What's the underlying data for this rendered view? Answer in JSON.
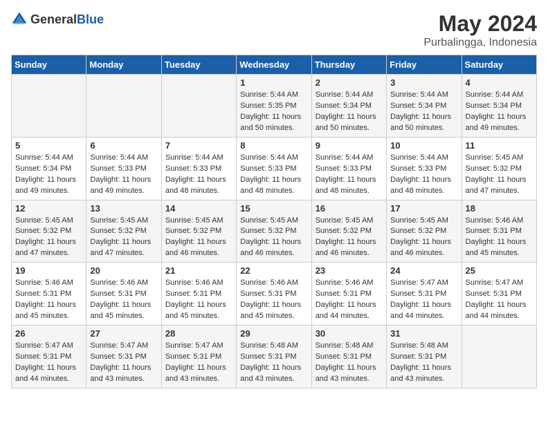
{
  "header": {
    "logo_general": "General",
    "logo_blue": "Blue",
    "month_year": "May 2024",
    "location": "Purbalingga, Indonesia"
  },
  "days_of_week": [
    "Sunday",
    "Monday",
    "Tuesday",
    "Wednesday",
    "Thursday",
    "Friday",
    "Saturday"
  ],
  "weeks": [
    [
      {
        "day": "",
        "info": ""
      },
      {
        "day": "",
        "info": ""
      },
      {
        "day": "",
        "info": ""
      },
      {
        "day": "1",
        "info": "Sunrise: 5:44 AM\nSunset: 5:35 PM\nDaylight: 11 hours\nand 50 minutes."
      },
      {
        "day": "2",
        "info": "Sunrise: 5:44 AM\nSunset: 5:34 PM\nDaylight: 11 hours\nand 50 minutes."
      },
      {
        "day": "3",
        "info": "Sunrise: 5:44 AM\nSunset: 5:34 PM\nDaylight: 11 hours\nand 50 minutes."
      },
      {
        "day": "4",
        "info": "Sunrise: 5:44 AM\nSunset: 5:34 PM\nDaylight: 11 hours\nand 49 minutes."
      }
    ],
    [
      {
        "day": "5",
        "info": "Sunrise: 5:44 AM\nSunset: 5:34 PM\nDaylight: 11 hours\nand 49 minutes."
      },
      {
        "day": "6",
        "info": "Sunrise: 5:44 AM\nSunset: 5:33 PM\nDaylight: 11 hours\nand 49 minutes."
      },
      {
        "day": "7",
        "info": "Sunrise: 5:44 AM\nSunset: 5:33 PM\nDaylight: 11 hours\nand 48 minutes."
      },
      {
        "day": "8",
        "info": "Sunrise: 5:44 AM\nSunset: 5:33 PM\nDaylight: 11 hours\nand 48 minutes."
      },
      {
        "day": "9",
        "info": "Sunrise: 5:44 AM\nSunset: 5:33 PM\nDaylight: 11 hours\nand 48 minutes."
      },
      {
        "day": "10",
        "info": "Sunrise: 5:44 AM\nSunset: 5:33 PM\nDaylight: 11 hours\nand 48 minutes."
      },
      {
        "day": "11",
        "info": "Sunrise: 5:45 AM\nSunset: 5:32 PM\nDaylight: 11 hours\nand 47 minutes."
      }
    ],
    [
      {
        "day": "12",
        "info": "Sunrise: 5:45 AM\nSunset: 5:32 PM\nDaylight: 11 hours\nand 47 minutes."
      },
      {
        "day": "13",
        "info": "Sunrise: 5:45 AM\nSunset: 5:32 PM\nDaylight: 11 hours\nand 47 minutes."
      },
      {
        "day": "14",
        "info": "Sunrise: 5:45 AM\nSunset: 5:32 PM\nDaylight: 11 hours\nand 46 minutes."
      },
      {
        "day": "15",
        "info": "Sunrise: 5:45 AM\nSunset: 5:32 PM\nDaylight: 11 hours\nand 46 minutes."
      },
      {
        "day": "16",
        "info": "Sunrise: 5:45 AM\nSunset: 5:32 PM\nDaylight: 11 hours\nand 46 minutes."
      },
      {
        "day": "17",
        "info": "Sunrise: 5:45 AM\nSunset: 5:32 PM\nDaylight: 11 hours\nand 46 minutes."
      },
      {
        "day": "18",
        "info": "Sunrise: 5:46 AM\nSunset: 5:31 PM\nDaylight: 11 hours\nand 45 minutes."
      }
    ],
    [
      {
        "day": "19",
        "info": "Sunrise: 5:46 AM\nSunset: 5:31 PM\nDaylight: 11 hours\nand 45 minutes."
      },
      {
        "day": "20",
        "info": "Sunrise: 5:46 AM\nSunset: 5:31 PM\nDaylight: 11 hours\nand 45 minutes."
      },
      {
        "day": "21",
        "info": "Sunrise: 5:46 AM\nSunset: 5:31 PM\nDaylight: 11 hours\nand 45 minutes."
      },
      {
        "day": "22",
        "info": "Sunrise: 5:46 AM\nSunset: 5:31 PM\nDaylight: 11 hours\nand 45 minutes."
      },
      {
        "day": "23",
        "info": "Sunrise: 5:46 AM\nSunset: 5:31 PM\nDaylight: 11 hours\nand 44 minutes."
      },
      {
        "day": "24",
        "info": "Sunrise: 5:47 AM\nSunset: 5:31 PM\nDaylight: 11 hours\nand 44 minutes."
      },
      {
        "day": "25",
        "info": "Sunrise: 5:47 AM\nSunset: 5:31 PM\nDaylight: 11 hours\nand 44 minutes."
      }
    ],
    [
      {
        "day": "26",
        "info": "Sunrise: 5:47 AM\nSunset: 5:31 PM\nDaylight: 11 hours\nand 44 minutes."
      },
      {
        "day": "27",
        "info": "Sunrise: 5:47 AM\nSunset: 5:31 PM\nDaylight: 11 hours\nand 43 minutes."
      },
      {
        "day": "28",
        "info": "Sunrise: 5:47 AM\nSunset: 5:31 PM\nDaylight: 11 hours\nand 43 minutes."
      },
      {
        "day": "29",
        "info": "Sunrise: 5:48 AM\nSunset: 5:31 PM\nDaylight: 11 hours\nand 43 minutes."
      },
      {
        "day": "30",
        "info": "Sunrise: 5:48 AM\nSunset: 5:31 PM\nDaylight: 11 hours\nand 43 minutes."
      },
      {
        "day": "31",
        "info": "Sunrise: 5:48 AM\nSunset: 5:31 PM\nDaylight: 11 hours\nand 43 minutes."
      },
      {
        "day": "",
        "info": ""
      }
    ]
  ]
}
